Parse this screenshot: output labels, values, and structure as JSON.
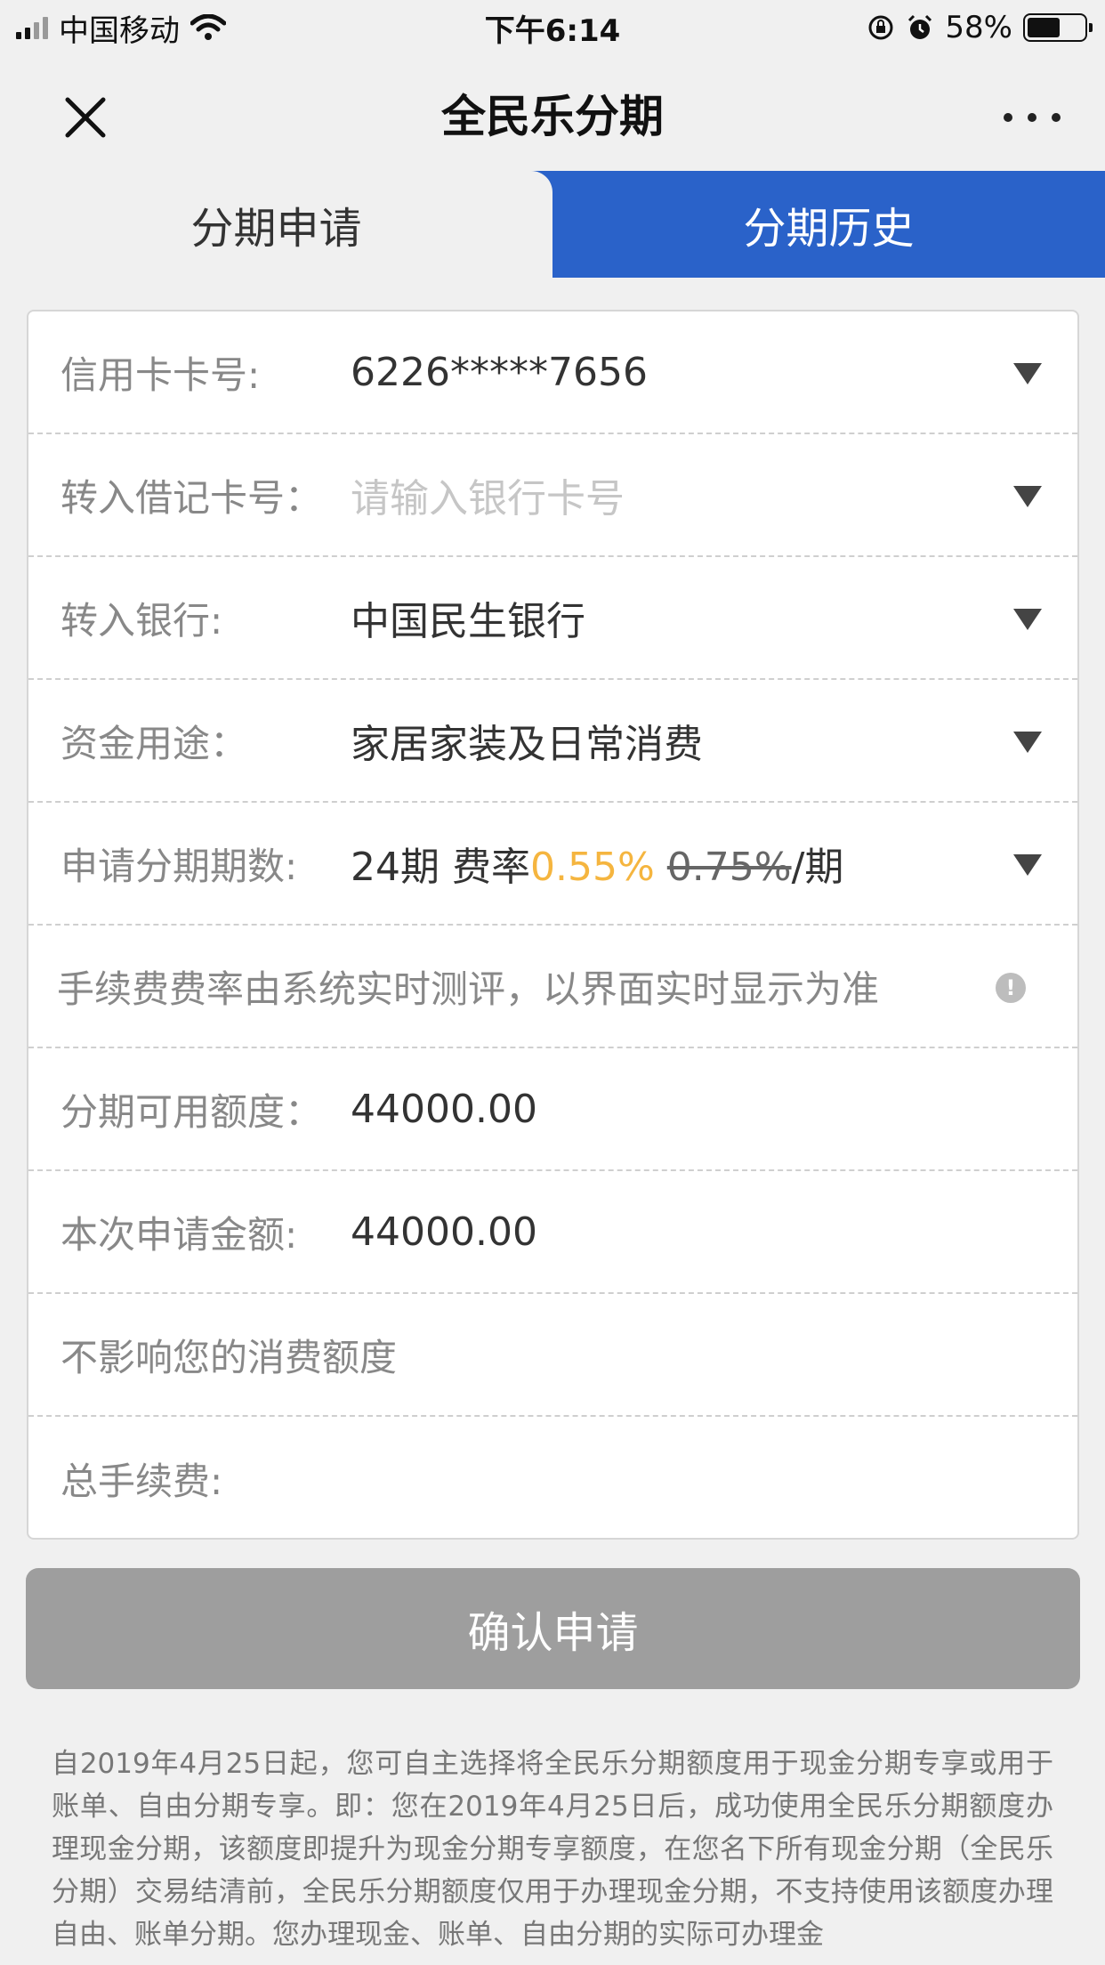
{
  "status_bar": {
    "carrier": "中国移动",
    "time": "下午6:14",
    "battery": "58%",
    "battery_level": 0.58,
    "icons": [
      "signal-icon",
      "wifi-icon",
      "rotation-lock-icon",
      "alarm-icon",
      "battery-icon"
    ]
  },
  "nav": {
    "title": "全民乐分期",
    "close_icon": "close-icon",
    "more_icon": "more-icon"
  },
  "tabs": [
    {
      "label": "分期申请",
      "active": true
    },
    {
      "label": "分期历史",
      "active": false
    }
  ],
  "form": {
    "credit_card": {
      "label": "信用卡卡号:",
      "value": "6226*****7656"
    },
    "debit_card": {
      "label": "转入借记卡号：",
      "placeholder": "请输入银行卡号"
    },
    "bank": {
      "label": "转入银行:",
      "value": "中国民生银行"
    },
    "purpose": {
      "label": "资金用途：",
      "value": "家居家装及日常消费"
    },
    "periods": {
      "label": "申请分期期数:",
      "count": "24期",
      "rate_label": "费率",
      "rate_new": "0.55%",
      "rate_old": "0.75%",
      "rate_suffix": "/期"
    },
    "fee_note": "手续费费率由系统实时测评，以界面实时显示为准",
    "available": {
      "label": "分期可用额度：",
      "value": "44000.00"
    },
    "amount": {
      "label": "本次申请金额:",
      "value": "44000.00"
    },
    "limit_note": "不影响您的消费额度",
    "total_fee": {
      "label": "总手续费:",
      "value": ""
    }
  },
  "confirm_button": "确认申请",
  "notice": "自2019年4月25日起，您可自主选择将全民乐分期额度用于现金分期专享或用于账单、自由分期专享。即：您在2019年4月25日后，成功使用全民乐分期额度办理现金分期，该额度即提升为现金分期专享额度，在您名下所有现金分期（全民乐分期）交易结清前，全民乐分期额度仅用于办理现金分期，不支持使用该额度办理自由、账单分期。您办理现金、账单、自由分期的实际可办理金",
  "colors": {
    "accent": "#2a62c9",
    "rate_highlight": "#f5b53f",
    "button_disabled": "#9e9e9e"
  }
}
